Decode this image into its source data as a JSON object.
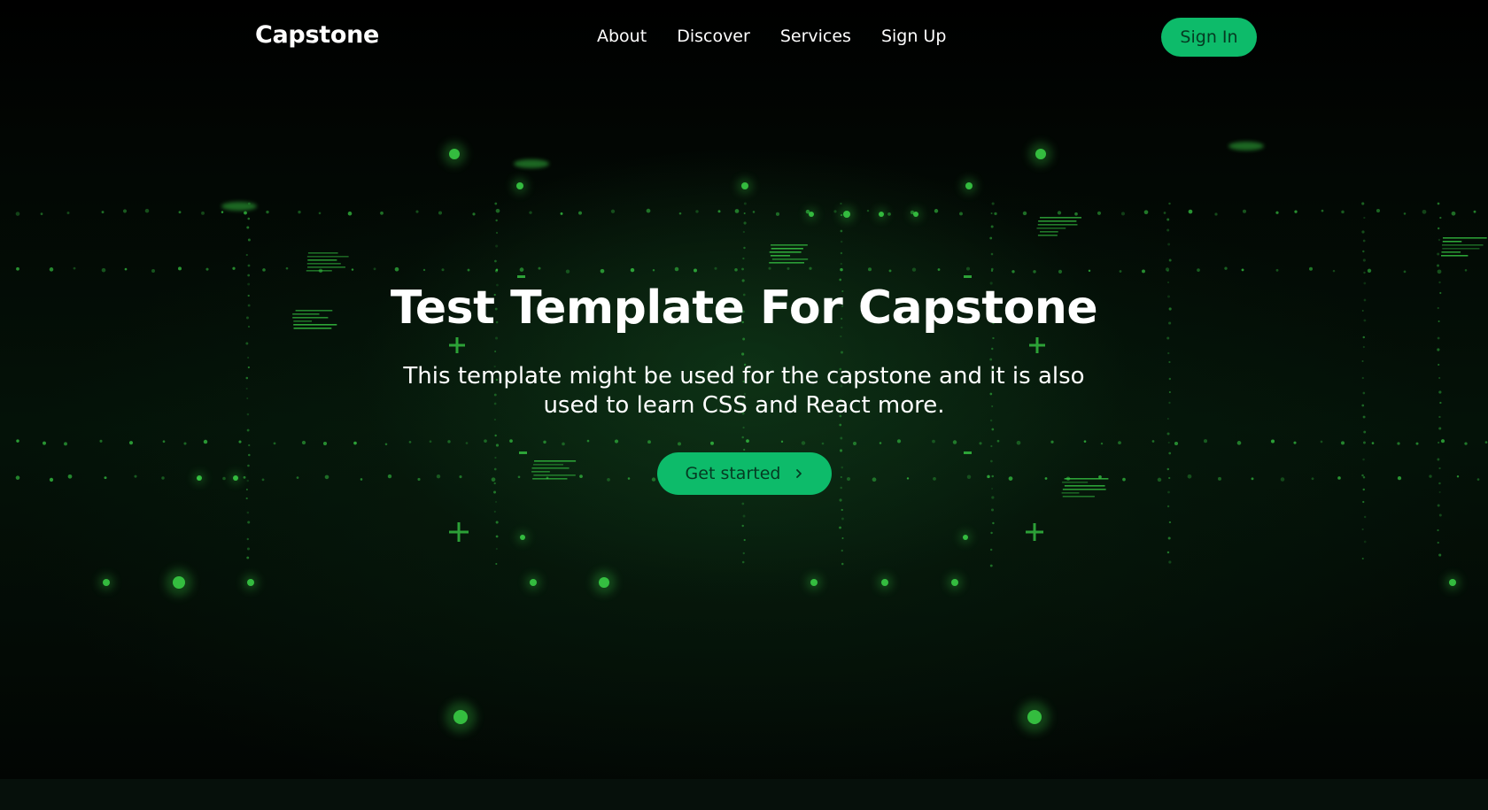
{
  "nav": {
    "logo": "Capstone",
    "links": [
      {
        "label": "About"
      },
      {
        "label": "Discover"
      },
      {
        "label": "Services"
      },
      {
        "label": "Sign Up"
      }
    ],
    "signin_label": "Sign In"
  },
  "hero": {
    "title": "Test Template For Capstone",
    "subtitle": "This template might be used for the capstone and it is also used to learn CSS and React more.",
    "cta_label": "Get started",
    "cta_icon": "chevron-right-icon"
  },
  "colors": {
    "accent": "#0dbb6a",
    "accent_text": "#053a22",
    "background": "#030704",
    "glow": "#3ddc4a"
  }
}
